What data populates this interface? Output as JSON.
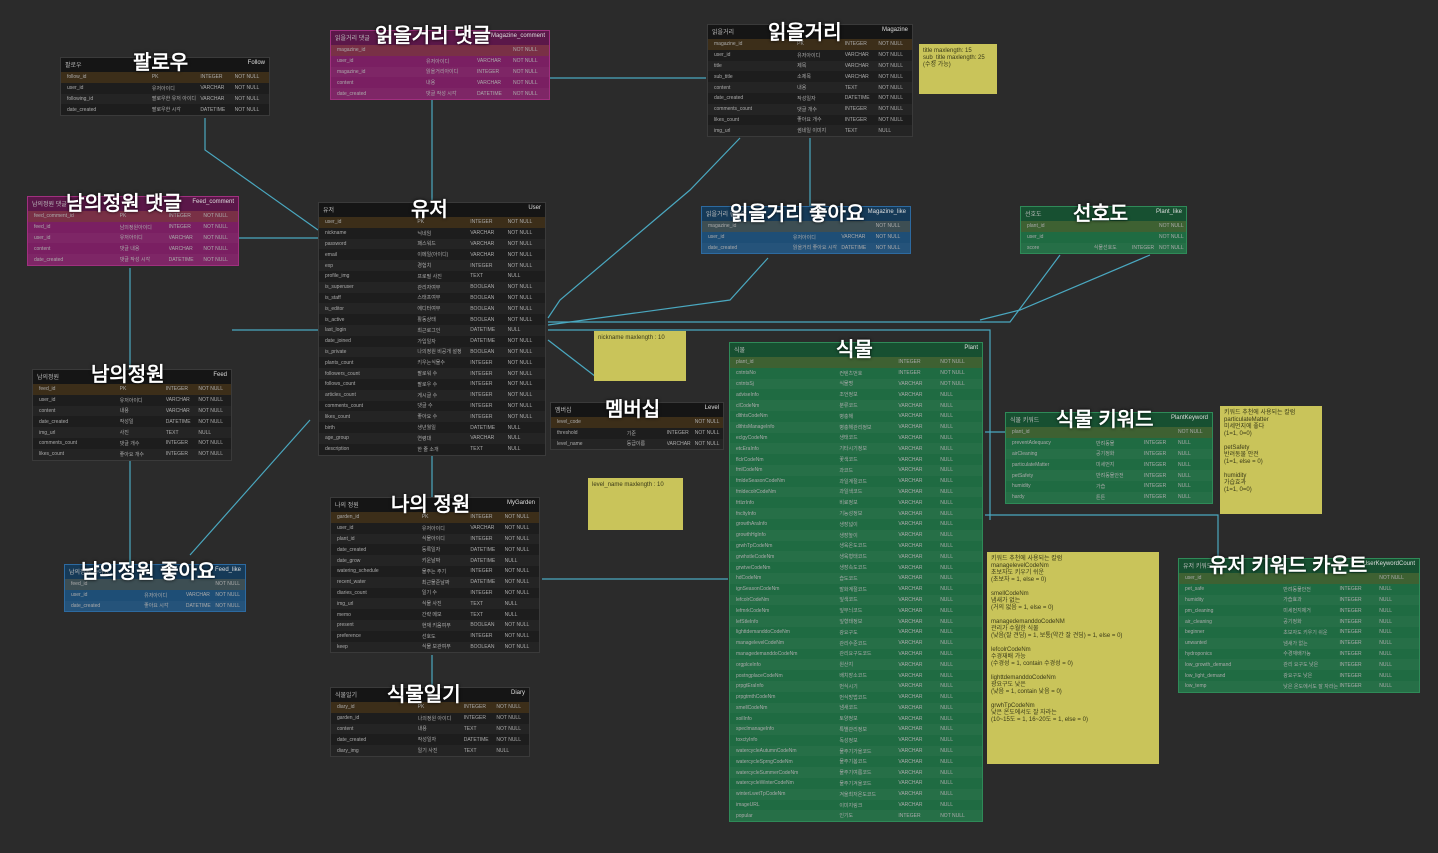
{
  "tables": [
    {
      "id": "follow",
      "title": "팔로우",
      "ko": "팔로우",
      "en": "Follow",
      "color": "dark",
      "rows": [
        [
          "follow_id",
          "PK",
          "INTEGER",
          "NOT NULL"
        ],
        [
          "user_id",
          "유저아이디",
          "VARCHAR",
          "NOT NULL"
        ],
        [
          "following_id",
          "팔로우한 유저 아이디",
          "VARCHAR",
          "NOT NULL"
        ],
        [
          "date_created",
          "팔로우한 시각",
          "DATETIME",
          "NOT NULL"
        ]
      ]
    },
    {
      "id": "magazine_comment",
      "title": "읽을거리 댓글",
      "ko": "읽을거리 댓글",
      "en": "Magazine_comment",
      "color": "pink",
      "rows": [
        [
          "magazine_id",
          "",
          "",
          "NOT NULL"
        ],
        [
          "user_id",
          "유저아이디",
          "VARCHAR",
          "NOT NULL"
        ],
        [
          "magazine_id",
          "읽을거리아이디",
          "INTEGER",
          "NOT NULL"
        ],
        [
          "content",
          "내용",
          "VARCHAR",
          "NOT NULL"
        ],
        [
          "date_created",
          "댓글 작성 시각",
          "DATETIME",
          "NOT NULL"
        ]
      ]
    },
    {
      "id": "magazine",
      "title": "읽을거리",
      "ko": "읽을거리",
      "en": "Magazine",
      "color": "dark",
      "rows": [
        [
          "magazine_id",
          "PK",
          "INTEGER",
          "NOT NULL"
        ],
        [
          "user_id",
          "유저아이디",
          "VARCHAR",
          "NOT NULL"
        ],
        [
          "title",
          "제목",
          "VARCHAR",
          "NOT NULL"
        ],
        [
          "sub_title",
          "소제목",
          "VARCHAR",
          "NOT NULL"
        ],
        [
          "content",
          "내용",
          "TEXT",
          "NOT NULL"
        ],
        [
          "date_created",
          "작성일자",
          "DATETIME",
          "NOT NULL"
        ],
        [
          "comments_count",
          "댓글 개수",
          "INTEGER",
          "NOT NULL"
        ],
        [
          "likes_count",
          "좋아요 개수",
          "INTEGER",
          "NOT NULL"
        ],
        [
          "img_url",
          "썸네일 이미지",
          "TEXT",
          "NULL"
        ]
      ]
    },
    {
      "id": "feed_comment",
      "title": "남의정원 댓글",
      "ko": "남의정원 댓글",
      "en": "Feed_comment",
      "color": "pink",
      "rows": [
        [
          "feed_comment_id",
          "PK",
          "INTEGER",
          "NOT NULL"
        ],
        [
          "feed_id",
          "남의정원아이디",
          "INTEGER",
          "NOT NULL"
        ],
        [
          "user_id",
          "유저아이디",
          "VARCHAR",
          "NOT NULL"
        ],
        [
          "content",
          "댓글 내용",
          "VARCHAR",
          "NOT NULL"
        ],
        [
          "date_created",
          "댓글 작성 시각",
          "DATETIME",
          "NOT NULL"
        ]
      ]
    },
    {
      "id": "user",
      "title": "유저",
      "ko": "유저",
      "en": "User",
      "color": "dark",
      "rows": [
        [
          "user_id",
          "PK",
          "INTEGER",
          "NOT NULL"
        ],
        [
          "nickname",
          "닉네임",
          "VARCHAR",
          "NOT NULL"
        ],
        [
          "password",
          "패스워드",
          "VARCHAR",
          "NOT NULL"
        ],
        [
          "email",
          "이메일(아이디)",
          "VARCHAR",
          "NOT NULL"
        ],
        [
          "exp",
          "경험치",
          "INTEGER",
          "NOT NULL"
        ],
        [
          "profile_img",
          "프로필 사진",
          "TEXT",
          "NULL"
        ],
        [
          "is_superuser",
          "관리자여부",
          "BOOLEAN",
          "NOT NULL"
        ],
        [
          "is_staff",
          "스태프여부",
          "BOOLEAN",
          "NOT NULL"
        ],
        [
          "is_editor",
          "에디터여부",
          "BOOLEAN",
          "NOT NULL"
        ],
        [
          "is_active",
          "활동상태",
          "BOOLEAN",
          "NOT NULL"
        ],
        [
          "last_login",
          "최근로그인",
          "DATETIME",
          "NULL"
        ],
        [
          "date_joined",
          "가입일자",
          "DATETIME",
          "NOT NULL"
        ],
        [
          "is_private",
          "나의정원 비공개 설정",
          "BOOLEAN",
          "NOT NULL"
        ],
        [
          "plants_count",
          "키우는식물수",
          "INTEGER",
          "NOT NULL"
        ],
        [
          "followers_count",
          "팔로워 수",
          "INTEGER",
          "NOT NULL"
        ],
        [
          "follows_count",
          "팔로우 수",
          "INTEGER",
          "NOT NULL"
        ],
        [
          "articles_count",
          "게시글 수",
          "INTEGER",
          "NOT NULL"
        ],
        [
          "comments_count",
          "댓글 수",
          "INTEGER",
          "NOT NULL"
        ],
        [
          "likes_count",
          "좋아요 수",
          "INTEGER",
          "NOT NULL"
        ],
        [
          "birth",
          "생년월일",
          "DATETIME",
          "NULL"
        ],
        [
          "age_group",
          "연령대",
          "VARCHAR",
          "NULL"
        ],
        [
          "description",
          "한 줄 소개",
          "TEXT",
          "NULL"
        ]
      ]
    },
    {
      "id": "magazine_like",
      "title": "읽을거리 좋아요",
      "ko": "읽을거리 좋아요",
      "en": "Magazine_like",
      "color": "blue",
      "rows": [
        [
          "magazine_id",
          "",
          "",
          "NOT NULL"
        ],
        [
          "user_id",
          "유저아이디",
          "VARCHAR",
          "NOT NULL"
        ],
        [
          "date_created",
          "읽을거리 좋아요 시각",
          "DATETIME",
          "NOT NULL"
        ]
      ]
    },
    {
      "id": "plant_like",
      "title": "선호도",
      "ko": "선호도",
      "en": "Plant_like",
      "color": "green",
      "rows": [
        [
          "plant_id",
          "",
          "",
          "NOT NULL"
        ],
        [
          "user_id",
          "",
          "",
          "NOT NULL"
        ],
        [
          "score",
          "식물선호도",
          "INTEGER",
          "NOT NULL"
        ]
      ]
    },
    {
      "id": "feed",
      "title": "남의정원",
      "ko": "남의정원",
      "en": "Feed",
      "color": "dark",
      "rows": [
        [
          "feed_id",
          "PK",
          "INTEGER",
          "NOT NULL"
        ],
        [
          "user_id",
          "유저아이디",
          "VARCHAR",
          "NOT NULL"
        ],
        [
          "content",
          "내용",
          "VARCHAR",
          "NOT NULL"
        ],
        [
          "date_created",
          "작성일",
          "DATETIME",
          "NOT NULL"
        ],
        [
          "img_url",
          "사진",
          "TEXT",
          "NULL"
        ],
        [
          "comments_count",
          "댓글 개수",
          "INTEGER",
          "NOT NULL"
        ],
        [
          "likes_count",
          "좋아요 개수",
          "INTEGER",
          "NOT NULL"
        ]
      ]
    },
    {
      "id": "level",
      "title": "멤버십",
      "ko": "멤버십",
      "en": "Level",
      "color": "dark",
      "rows": [
        [
          "level_code",
          "",
          "",
          "NOT NULL"
        ],
        [
          "threshold",
          "기준",
          "INTEGER",
          "NOT NULL"
        ],
        [
          "level_name",
          "등급이름",
          "VARCHAR",
          "NOT NULL"
        ]
      ]
    },
    {
      "id": "plant",
      "title": "식물",
      "ko": "식물",
      "en": "Plant",
      "color": "green",
      "rows": [
        [
          "plant_id",
          "",
          "INTEGER",
          "NOT NULL"
        ],
        [
          "cntntsNo",
          "컨텐츠번호",
          "INTEGER",
          "NOT NULL"
        ],
        [
          "cntntsSj",
          "식물명",
          "VARCHAR",
          "NOT NULL"
        ],
        [
          "adviseInfo",
          "조언정보",
          "VARCHAR",
          "NULL"
        ],
        [
          "clCodeNm",
          "분류코드",
          "VARCHAR",
          "NULL"
        ],
        [
          "dlthtsCodeNm",
          "병충해",
          "VARCHAR",
          "NULL"
        ],
        [
          "dlthtsManageInfo",
          "병충해관리정보",
          "VARCHAR",
          "NULL"
        ],
        [
          "eclgyCodeNm",
          "생태코드",
          "VARCHAR",
          "NULL"
        ],
        [
          "etcEraInfo",
          "기타시기정보",
          "VARCHAR",
          "NULL"
        ],
        [
          "flclrCodeNm",
          "꽃색코드",
          "VARCHAR",
          "NULL"
        ],
        [
          "fmlCodeNm",
          "과코드",
          "VARCHAR",
          "NULL"
        ],
        [
          "fmldeSeasonCodeNm",
          "과일계절코드",
          "VARCHAR",
          "NULL"
        ],
        [
          "fmldecolrCodeNm",
          "과일색코드",
          "VARCHAR",
          "NULL"
        ],
        [
          "frtlzrInfo",
          "비료정보",
          "VARCHAR",
          "NULL"
        ],
        [
          "fncltyInfo",
          "기능성정보",
          "VARCHAR",
          "NULL"
        ],
        [
          "growthAraInfo",
          "생장넓이",
          "VARCHAR",
          "NULL"
        ],
        [
          "growthHgInfo",
          "생장높이",
          "VARCHAR",
          "NULL"
        ],
        [
          "grwhTpCodeNm",
          "생육온도코드",
          "VARCHAR",
          "NULL"
        ],
        [
          "grwhstleCodeNm",
          "생육형태코드",
          "VARCHAR",
          "NULL"
        ],
        [
          "grwtveCodeNm",
          "생장속도코드",
          "VARCHAR",
          "NULL"
        ],
        [
          "hdCodeNm",
          "습도코드",
          "VARCHAR",
          "NULL"
        ],
        [
          "ignSeasonCodeNm",
          "발화계절코드",
          "VARCHAR",
          "NULL"
        ],
        [
          "lefcolrCodeNm",
          "잎색코드",
          "VARCHAR",
          "NULL"
        ],
        [
          "lefmrkCodeNm",
          "잎무늬코드",
          "VARCHAR",
          "NULL"
        ],
        [
          "lefStleInfo",
          "잎형태정보",
          "VARCHAR",
          "NULL"
        ],
        [
          "lighttdemanddoCodeNm",
          "광요구도",
          "VARCHAR",
          "NULL"
        ],
        [
          "managelevelCodeNm",
          "관리수준코드",
          "VARCHAR",
          "NULL"
        ],
        [
          "managedemanddoCodeNm",
          "관리요구도코드",
          "VARCHAR",
          "NULL"
        ],
        [
          "orgplceInfo",
          "원산지",
          "VARCHAR",
          "NULL"
        ],
        [
          "postngplaceCodeNm",
          "배치장소코드",
          "VARCHAR",
          "NULL"
        ],
        [
          "prpgtEraInfo",
          "번식시기",
          "VARCHAR",
          "NULL"
        ],
        [
          "prpgtmthCodeNm",
          "번식방법코드",
          "VARCHAR",
          "NULL"
        ],
        [
          "smellCodeNm",
          "냄새코드",
          "VARCHAR",
          "NULL"
        ],
        [
          "soilInfo",
          "토양정보",
          "VARCHAR",
          "NULL"
        ],
        [
          "speclmanageInfo",
          "특별관리정보",
          "VARCHAR",
          "NULL"
        ],
        [
          "toxctyInfo",
          "독성정보",
          "VARCHAR",
          "NULL"
        ],
        [
          "watercycleAutumnCodeNm",
          "물주기가을코드",
          "VARCHAR",
          "NULL"
        ],
        [
          "watercycleSprngCodeNm",
          "물주기봄코드",
          "VARCHAR",
          "NULL"
        ],
        [
          "watercycleSummerCodeNm",
          "물주기여름코드",
          "VARCHAR",
          "NULL"
        ],
        [
          "watercycleWinterCodeNm",
          "물주기겨울코드",
          "VARCHAR",
          "NULL"
        ],
        [
          "winterLwetTpCodeNm",
          "겨울최저온도코드",
          "VARCHAR",
          "NULL"
        ],
        [
          "imageURL",
          "이미지링크",
          "VARCHAR",
          "NULL"
        ],
        [
          "popular",
          "인기도",
          "INTEGER",
          "NOT NULL"
        ]
      ]
    },
    {
      "id": "plant_keyword",
      "title": "식물 키워드",
      "ko": "식물 키워드",
      "en": "PlantKeyword",
      "color": "green",
      "rows": [
        [
          "plant_id",
          "",
          "",
          "NOT NULL"
        ],
        [
          "preventAdequacy",
          "반려동물",
          "INTEGER",
          "NULL"
        ],
        [
          "airCleaning",
          "공기정화",
          "INTEGER",
          "NULL"
        ],
        [
          "particulateMatter",
          "미세먼지",
          "INTEGER",
          "NULL"
        ],
        [
          "petSafety",
          "반려동물안전",
          "INTEGER",
          "NULL"
        ],
        [
          "humidity",
          "가습",
          "INTEGER",
          "NULL"
        ],
        [
          "hardy",
          "튼튼",
          "INTEGER",
          "NULL"
        ]
      ]
    },
    {
      "id": "my_garden",
      "title": "나의 정원",
      "ko": "나의 정원",
      "en": "MyGarden",
      "color": "dark",
      "rows": [
        [
          "garden_id",
          "PK",
          "INTEGER",
          "NOT NULL"
        ],
        [
          "user_id",
          "유저아이디",
          "VARCHAR",
          "NOT NULL"
        ],
        [
          "plant_id",
          "식물아이디",
          "INTEGER",
          "NOT NULL"
        ],
        [
          "date_created",
          "등록일자",
          "DATETIME",
          "NOT NULL"
        ],
        [
          "date_grow",
          "키운날짜",
          "DATETIME",
          "NULL"
        ],
        [
          "watering_schedule",
          "물주는 주기",
          "INTEGER",
          "NOT NULL"
        ],
        [
          "recent_water",
          "최근물준날짜",
          "DATETIME",
          "NOT NULL"
        ],
        [
          "diaries_count",
          "일기 수",
          "INTEGER",
          "NOT NULL"
        ],
        [
          "img_url",
          "식물 사진",
          "TEXT",
          "NULL"
        ],
        [
          "memo",
          "간략 메모",
          "TEXT",
          "NULL"
        ],
        [
          "present",
          "현재 키움여부",
          "BOOLEAN",
          "NOT NULL"
        ],
        [
          "preference",
          "선호도",
          "INTEGER",
          "NOT NULL"
        ],
        [
          "keep",
          "식물 보관여부",
          "BOOLEAN",
          "NOT NULL"
        ]
      ]
    },
    {
      "id": "feed_like",
      "title": "남의정원 좋아요",
      "ko": "남의정원 좋아요",
      "en": "Feed_like",
      "color": "blue",
      "rows": [
        [
          "feed_id",
          "",
          "",
          "NOT NULL"
        ],
        [
          "user_id",
          "유저아이디",
          "VARCHAR",
          "NOT NULL"
        ],
        [
          "date_created",
          "좋아요 시각",
          "DATETIME",
          "NOT NULL"
        ]
      ]
    },
    {
      "id": "user_keyword_count",
      "title": "유저 키워드 카운트",
      "ko": "유저 키워드",
      "en": "UserKeywordCount",
      "color": "green",
      "rows": [
        [
          "user_id",
          "",
          "",
          "NOT NULL"
        ],
        [
          "pet_safe",
          "반려동물안전",
          "INTEGER",
          "NULL"
        ],
        [
          "humidity",
          "가습효과",
          "INTEGER",
          "NULL"
        ],
        [
          "pm_cleaning",
          "미세먼지제거",
          "INTEGER",
          "NULL"
        ],
        [
          "air_cleaning",
          "공기정화",
          "INTEGER",
          "NULL"
        ],
        [
          "beginner",
          "초보자도 키우기 쉬운",
          "INTEGER",
          "NULL"
        ],
        [
          "unwanted",
          "냄새가 없는",
          "INTEGER",
          "NULL"
        ],
        [
          "hydroponics",
          "수경재배가능",
          "INTEGER",
          "NULL"
        ],
        [
          "low_growth_demand",
          "관리 요구도 낮은",
          "INTEGER",
          "NULL"
        ],
        [
          "low_light_demand",
          "광요구도 낮은",
          "INTEGER",
          "NULL"
        ],
        [
          "low_temp",
          "낮은 온도에서도 잘 자라는",
          "INTEGER",
          "NULL"
        ]
      ]
    },
    {
      "id": "diary",
      "title": "식물일기",
      "ko": "식물일기",
      "en": "Diary",
      "color": "dark",
      "rows": [
        [
          "diary_id",
          "PK",
          "INTEGER",
          "NOT NULL"
        ],
        [
          "garden_id",
          "나의정원 아이디",
          "INTEGER",
          "NOT NULL"
        ],
        [
          "content",
          "내용",
          "TEXT",
          "NOT NULL"
        ],
        [
          "date_created",
          "작성일자",
          "DATETIME",
          "NOT NULL"
        ],
        [
          "diary_img",
          "일기 사진",
          "TEXT",
          "NULL"
        ]
      ]
    }
  ],
  "notes": [
    {
      "id": "note_title",
      "text": "title maxlength: 15\nsub_title maxlength: 25\n(수정 가능)"
    },
    {
      "id": "note_nickname",
      "text": "nickname maxlength : 10"
    },
    {
      "id": "note_level",
      "text": "level_name maxlength : 10"
    },
    {
      "id": "note_keyword",
      "text": "키워드 추천에 사용되는 칼럼\nparticulateMatter\n미세먼지에 좋다\n(1=1, 0=0)\n\npetSafety\n반려동물 안전\n(1=1, else = 0)\n\nhumidity\n가습효과\n(1=1, 0=0)"
    },
    {
      "id": "note_columns",
      "text": "키워드 추천에 사용되는 칼럼\nmanagelevelCodeNm\n초보자도 키우기 쉬운\n(초보자 = 1, else = 0)\n\nsmellCodeNm\n냄새가 없는\n(거의 없음 = 1, else = 0)\n\nmanagedemanddoCodeNM\n관리가 수월한 식물\n(낮음(잘 견딤) = 1, 보통(약간 잘 견딤) = 1, else = 0)\n\nlefcolrCodeNm\n수경재배 가능\n(수경성 = 1, contain 수경성 = 0)\n\nlighttdemanddoCodeNm\n광요구도 낮은\n(낮음 = 1, contain 낮음 = 0)\n\ngrwhTpCodeNm\n낮은 온도에서도 잘 자라는\n(10~15도 = 1, 16~20도 = 1, else = 0)"
    }
  ]
}
